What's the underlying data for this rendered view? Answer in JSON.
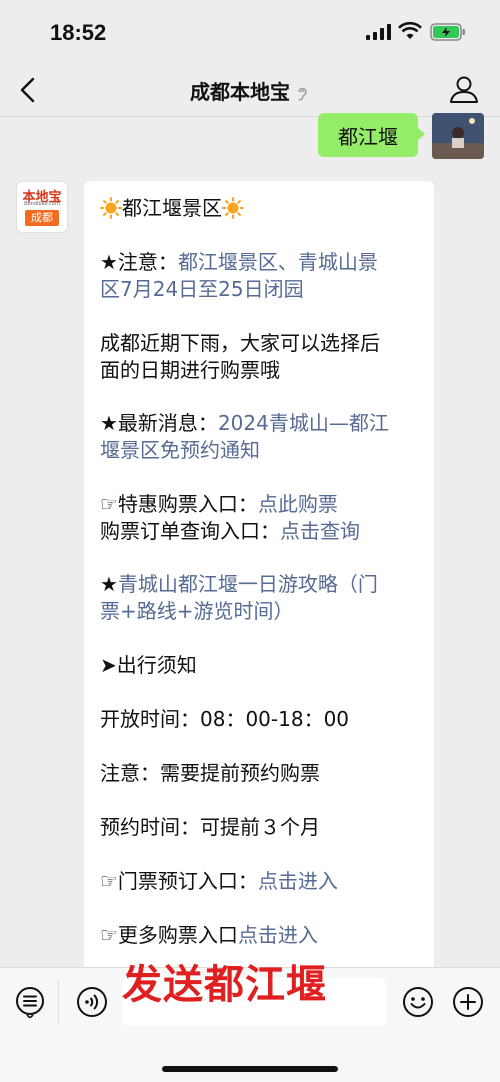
{
  "status": {
    "time": "18:52"
  },
  "nav": {
    "title": "成都本地宝"
  },
  "sent": {
    "text": "都江堰"
  },
  "bot": {
    "logo_top": "本地宝",
    "logo_small": "Bendibao.com",
    "logo_tag": "成都"
  },
  "message": {
    "title": "都江堰景区",
    "notice_prefix": "★注意：",
    "notice_link_1": "都江堰景区、青城山景",
    "notice_link_2": "区7月24日至25日闭园",
    "rain_1": "成都近期下雨，大家可以选择后",
    "rain_2": "面的日期进行购票哦",
    "news_prefix": "★最新消息：",
    "news_link_1": "2024青城山—都江",
    "news_link_2": "堰景区免预约通知",
    "discount_prefix": "☞特惠购票入口：",
    "discount_link": "点此购票",
    "order_prefix": "购票订单查询入口：",
    "order_link": "点击查询",
    "guide_star": "★",
    "guide_link_1": "青城山都江堰一日游攻略（门",
    "guide_link_2": "票+路线+游览时间）",
    "travel_notice": "➤出行须知",
    "hours": "开放时间：08：00-18：00",
    "reserve_notice": "注意：需要提前预约购票",
    "reserve_time": "预约时间：可提前３个月",
    "ticket_prefix": "☞门票预订入口：",
    "ticket_link": "点击进入",
    "more_prefix": "☞更多购票入口",
    "more_link": "点击进入"
  },
  "overlay": {
    "text": "发送都江堰"
  },
  "colors": {
    "link": "#576b95",
    "sent_bubble": "#95ec69",
    "overlay": "#e02020"
  },
  "icons": [
    "back-arrow-icon",
    "ear-icon",
    "person-icon",
    "menu-icon",
    "voice-icon",
    "emoji-icon",
    "plus-icon",
    "sun-icon"
  ]
}
